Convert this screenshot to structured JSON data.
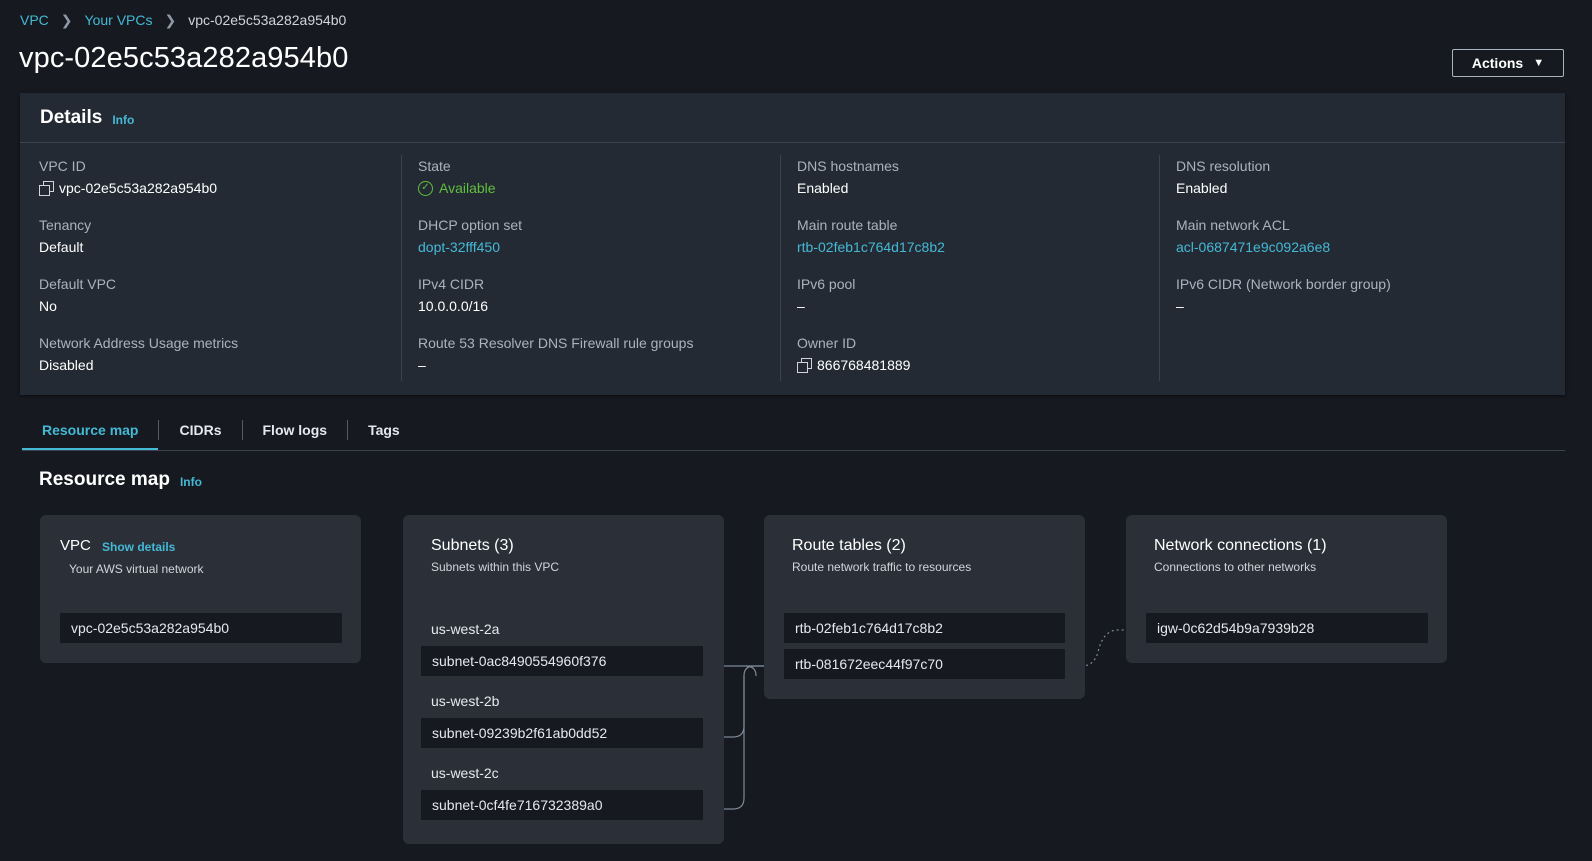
{
  "breadcrumb": [
    "VPC",
    "Your VPCs",
    "vpc-02e5c53a282a954b0"
  ],
  "page_title": "vpc-02e5c53a282a954b0",
  "actions_label": "Actions",
  "details": {
    "title": "Details",
    "info": "Info",
    "columns": [
      [
        {
          "label": "VPC ID",
          "value": "vpc-02e5c53a282a954b0",
          "copy": true
        },
        {
          "label": "Tenancy",
          "value": "Default"
        },
        {
          "label": "Default VPC",
          "value": "No"
        },
        {
          "label": "Network Address Usage metrics",
          "value": "Disabled"
        }
      ],
      [
        {
          "label": "State",
          "value": "Available",
          "status": "ok"
        },
        {
          "label": "DHCP option set",
          "value": "dopt-32fff450",
          "link": true
        },
        {
          "label": "IPv4 CIDR",
          "value": "10.0.0.0/16"
        },
        {
          "label": "Route 53 Resolver DNS Firewall rule groups",
          "value": "–"
        }
      ],
      [
        {
          "label": "DNS hostnames",
          "value": "Enabled"
        },
        {
          "label": "Main route table",
          "value": "rtb-02feb1c764d17c8b2",
          "link": true
        },
        {
          "label": "IPv6 pool",
          "value": "–"
        },
        {
          "label": "Owner ID",
          "value": "866768481889",
          "copy": true
        }
      ],
      [
        {
          "label": "DNS resolution",
          "value": "Enabled"
        },
        {
          "label": "Main network ACL",
          "value": "acl-0687471e9c092a6e8",
          "link": true
        },
        {
          "label": "IPv6 CIDR (Network border group)",
          "value": "–"
        }
      ]
    ]
  },
  "tabs": [
    "Resource map",
    "CIDRs",
    "Flow logs",
    "Tags"
  ],
  "active_tab": 0,
  "resource_map": {
    "title": "Resource map",
    "info": "Info",
    "vpc": {
      "title": "VPC",
      "show_details": "Show details",
      "subtitle": "Your AWS virtual network",
      "id": "vpc-02e5c53a282a954b0"
    },
    "subnets": {
      "title": "Subnets (3)",
      "subtitle": "Subnets within this VPC",
      "groups": [
        {
          "az": "us-west-2a",
          "subnet": "subnet-0ac8490554960f376"
        },
        {
          "az": "us-west-2b",
          "subnet": "subnet-09239b2f61ab0dd52"
        },
        {
          "az": "us-west-2c",
          "subnet": "subnet-0cf4fe716732389a0"
        }
      ]
    },
    "route_tables": {
      "title": "Route tables (2)",
      "subtitle": "Route network traffic to resources",
      "items": [
        "rtb-02feb1c764d17c8b2",
        "rtb-081672eec44f97c70"
      ]
    },
    "network_connections": {
      "title": "Network connections (1)",
      "subtitle": "Connections to other networks",
      "items": [
        "igw-0c62d54b9a7939b28"
      ]
    }
  },
  "colors": {
    "background": "#16191f",
    "panel": "#242a33",
    "card": "#2a2f38",
    "link": "#44b9d6",
    "success": "#5fbf3f"
  }
}
